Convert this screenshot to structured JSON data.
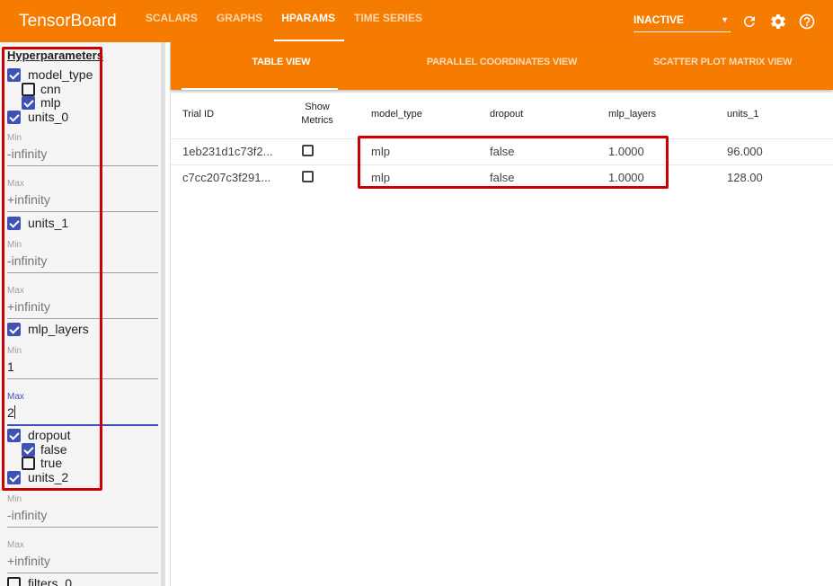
{
  "app": {
    "title": "TensorBoard",
    "nav": [
      {
        "label": "SCALARS",
        "active": false
      },
      {
        "label": "GRAPHS",
        "active": false
      },
      {
        "label": "HPARAMS",
        "active": true
      },
      {
        "label": "TIME SERIES",
        "active": false
      }
    ],
    "run_select": {
      "value": "INACTIVE"
    },
    "icons": [
      "refresh-icon",
      "settings-gear-icon",
      "help-icon"
    ]
  },
  "colors": {
    "brand_orange": "#f57c00",
    "checkbox_accent": "#3f51b5",
    "highlight_red": "#cc0000"
  },
  "sidebar": {
    "title": "Hyperparameters",
    "model_type": {
      "label": "model_type",
      "checked": true,
      "options": [
        {
          "label": "cnn",
          "checked": false
        },
        {
          "label": "mlp",
          "checked": true
        }
      ]
    },
    "units_0": {
      "label": "units_0",
      "checked": true,
      "min_label": "Min",
      "min_value": "-infinity",
      "max_label": "Max",
      "max_value": "+infinity"
    },
    "units_1": {
      "label": "units_1",
      "checked": true,
      "min_label": "Min",
      "min_value": "-infinity",
      "max_label": "Max",
      "max_value": "+infinity"
    },
    "mlp_layers": {
      "label": "mlp_layers",
      "checked": true,
      "min_label": "Min",
      "min_value": "1",
      "max_label": "Max",
      "max_value": "2"
    },
    "dropout": {
      "label": "dropout",
      "checked": true,
      "options": [
        {
          "label": "false",
          "checked": true
        },
        {
          "label": "true",
          "checked": false
        }
      ]
    },
    "units_2": {
      "label": "units_2",
      "checked": true,
      "min_label": "Min",
      "min_value": "-infinity",
      "max_label": "Max",
      "max_value": "+infinity"
    },
    "filters_0": {
      "label": "filters_0",
      "checked": false
    }
  },
  "main": {
    "tabs": [
      {
        "label": "TABLE VIEW",
        "active": true
      },
      {
        "label": "PARALLEL COORDINATES VIEW",
        "active": false
      },
      {
        "label": "SCATTER PLOT MATRIX VIEW",
        "active": false
      }
    ],
    "table": {
      "headers": [
        "Trial ID",
        "Show Metrics",
        "model_type",
        "dropout",
        "mlp_layers",
        "units_1"
      ],
      "rows": [
        {
          "trial_id": "1eb231d1c73f2...",
          "show_metrics": false,
          "model_type": "mlp",
          "dropout": "false",
          "mlp_layers": "1.0000",
          "units_1": "96.000"
        },
        {
          "trial_id": "c7cc207c3f291...",
          "show_metrics": false,
          "model_type": "mlp",
          "dropout": "false",
          "mlp_layers": "1.0000",
          "units_1": "128.00"
        }
      ]
    }
  }
}
